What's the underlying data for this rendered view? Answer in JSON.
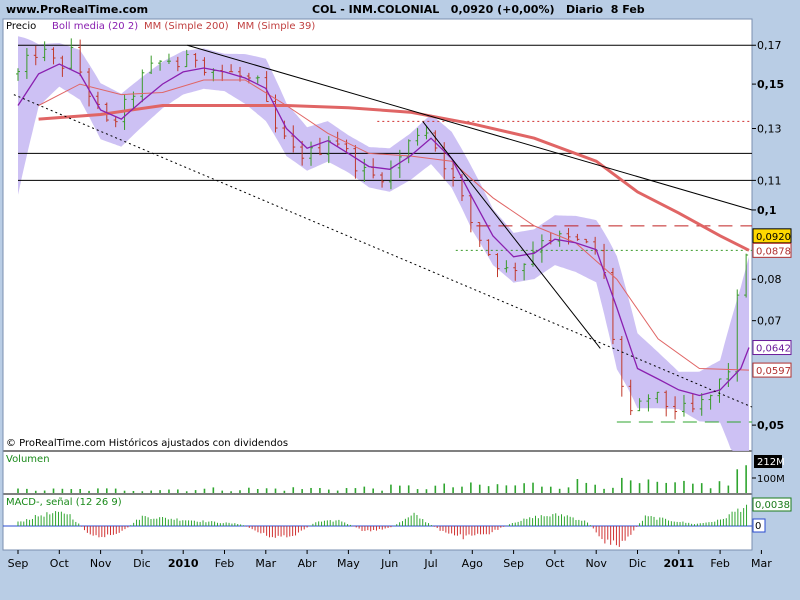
{
  "header": {
    "site": "www.ProRealTime.com",
    "title": "COL - INM.COLONIAL",
    "last": "0,0920 (+0,00%)",
    "period": "Diario",
    "date": "8 Feb"
  },
  "colors": {
    "background": "#b9cde5",
    "panel": "#ffffff",
    "candle_up": "#3a9a2a",
    "candle_down": "#c0392b",
    "bollinger_band": "#c8baf3",
    "bollinger_mid": "#8a20b0",
    "ma200": "#e06565",
    "ma39": "#e06565",
    "volume": "#2fa52f",
    "macd_pos": "#2fa52f",
    "macd_neg": "#d03030"
  },
  "price_panel": {
    "legend": {
      "precio": "Precio",
      "boll": "Boll media (20 2)",
      "ma200": "MM (Simple 200)",
      "ma39": "MM (Simple 39)"
    },
    "footer": "© ProRealTime.com  Históricos ajustados con dividendos",
    "axis_labels": [
      {
        "value": 0.17,
        "text": "0,17",
        "bold": false
      },
      {
        "value": 0.15,
        "text": "0,15",
        "bold": true
      },
      {
        "value": 0.13,
        "text": "0,13",
        "bold": false
      },
      {
        "value": 0.11,
        "text": "0,11",
        "bold": false
      },
      {
        "value": 0.1,
        "text": "0,1",
        "bold": true
      },
      {
        "value": 0.08,
        "text": "0,08",
        "bold": false
      },
      {
        "value": 0.07,
        "text": "0,07",
        "bold": false
      },
      {
        "value": 0.05,
        "text": "0,05",
        "bold": true
      }
    ],
    "price_tags": [
      {
        "value": 0.092,
        "text": "0,0920",
        "bg": "#ffd800",
        "fg": "#000000",
        "border": "#000000"
      },
      {
        "value": 0.0878,
        "text": "0,0878",
        "bg": "#ffffff",
        "fg": "#b03030",
        "border": "#b03030"
      },
      {
        "value": 0.0642,
        "text": "0,0642",
        "bg": "#ffffff",
        "fg": "#6a1b9a",
        "border": "#6a1b9a"
      },
      {
        "value": 0.0597,
        "text": "0,0597",
        "bg": "#ffffff",
        "fg": "#b03030",
        "border": "#b03030"
      }
    ]
  },
  "volume_panel": {
    "label": "Volumen",
    "tags": [
      {
        "text": "212M",
        "bg": "#000000",
        "fg": "#ffffff"
      },
      {
        "text": "100M",
        "bg": "none",
        "fg": "#000000"
      }
    ]
  },
  "macd_panel": {
    "label": "MACD-, señal (12 26 9)",
    "tags": [
      {
        "text": "0,0038",
        "bg": "#ffffff",
        "fg": "#1a7a1a"
      },
      {
        "text": "0",
        "bg": "#ffffff",
        "fg": "#000000"
      }
    ]
  },
  "chart_data": {
    "type": "candlestick",
    "scale": "log",
    "ylim": [
      0.046,
      0.185
    ],
    "x_ticks": [
      {
        "text": "Sep",
        "bold": false
      },
      {
        "text": "Oct",
        "bold": false
      },
      {
        "text": "Nov",
        "bold": false
      },
      {
        "text": "Dic",
        "bold": false
      },
      {
        "text": "2010",
        "bold": true
      },
      {
        "text": "Feb",
        "bold": false
      },
      {
        "text": "Mar",
        "bold": false
      },
      {
        "text": "Abr",
        "bold": false
      },
      {
        "text": "May",
        "bold": false
      },
      {
        "text": "Jun",
        "bold": false
      },
      {
        "text": "Jul",
        "bold": false
      },
      {
        "text": "Ago",
        "bold": false
      },
      {
        "text": "Sep",
        "bold": false
      },
      {
        "text": "Oct",
        "bold": false
      },
      {
        "text": "Nov",
        "bold": false
      },
      {
        "text": "Dic",
        "bold": false
      },
      {
        "text": "2011",
        "bold": true
      },
      {
        "text": "Feb",
        "bold": false
      },
      {
        "text": "Mar",
        "bold": false
      }
    ],
    "price_path": [
      [
        0,
        0.155
      ],
      [
        0.5,
        0.168
      ],
      [
        1,
        0.158
      ],
      [
        1.3,
        0.166
      ],
      [
        1.8,
        0.142
      ],
      [
        2.2,
        0.13
      ],
      [
        2.6,
        0.14
      ],
      [
        3.1,
        0.156
      ],
      [
        3.6,
        0.163
      ],
      [
        4,
        0.158
      ],
      [
        4.2,
        0.166
      ],
      [
        4.6,
        0.158
      ],
      [
        5.2,
        0.155
      ],
      [
        5.8,
        0.15
      ],
      [
        6.2,
        0.13
      ],
      [
        6.7,
        0.12
      ],
      [
        7.2,
        0.12
      ],
      [
        7.6,
        0.128
      ],
      [
        8,
        0.119
      ],
      [
        8.5,
        0.111
      ],
      [
        9,
        0.113
      ],
      [
        9.3,
        0.12
      ],
      [
        9.8,
        0.132
      ],
      [
        10.2,
        0.12
      ],
      [
        10.6,
        0.108
      ],
      [
        11,
        0.095
      ],
      [
        11.4,
        0.087
      ],
      [
        11.8,
        0.082
      ],
      [
        12.3,
        0.085
      ],
      [
        12.7,
        0.092
      ],
      [
        13.2,
        0.091
      ],
      [
        13.6,
        0.09
      ],
      [
        14.1,
        0.087
      ],
      [
        14.5,
        0.06
      ],
      [
        14.8,
        0.051
      ],
      [
        15.3,
        0.055
      ],
      [
        15.8,
        0.053
      ],
      [
        16.3,
        0.052
      ],
      [
        16.8,
        0.055
      ],
      [
        17.2,
        0.06
      ],
      [
        17.5,
        0.08
      ],
      [
        17.7,
        0.092
      ]
    ],
    "ma200_path": [
      [
        0.5,
        0.134
      ],
      [
        2,
        0.136
      ],
      [
        3.5,
        0.14
      ],
      [
        5,
        0.14
      ],
      [
        6.5,
        0.14
      ],
      [
        8,
        0.139
      ],
      [
        9.5,
        0.137
      ],
      [
        11,
        0.132
      ],
      [
        12.5,
        0.126
      ],
      [
        14,
        0.117
      ],
      [
        15,
        0.106
      ],
      [
        16,
        0.099
      ],
      [
        17,
        0.092
      ],
      [
        17.7,
        0.0878
      ]
    ],
    "boll_mid_path": [
      [
        0,
        0.14
      ],
      [
        0.5,
        0.155
      ],
      [
        1,
        0.16
      ],
      [
        1.5,
        0.155
      ],
      [
        2,
        0.138
      ],
      [
        2.5,
        0.134
      ],
      [
        3,
        0.142
      ],
      [
        3.5,
        0.15
      ],
      [
        4,
        0.156
      ],
      [
        4.5,
        0.158
      ],
      [
        5,
        0.156
      ],
      [
        5.5,
        0.153
      ],
      [
        6,
        0.148
      ],
      [
        6.5,
        0.13
      ],
      [
        7,
        0.122
      ],
      [
        7.5,
        0.125
      ],
      [
        8,
        0.12
      ],
      [
        8.5,
        0.115
      ],
      [
        9,
        0.114
      ],
      [
        9.5,
        0.119
      ],
      [
        10,
        0.126
      ],
      [
        10.5,
        0.118
      ],
      [
        11,
        0.104
      ],
      [
        11.5,
        0.092
      ],
      [
        12,
        0.086
      ],
      [
        12.5,
        0.087
      ],
      [
        13,
        0.091
      ],
      [
        13.5,
        0.09
      ],
      [
        14,
        0.088
      ],
      [
        14.5,
        0.073
      ],
      [
        15,
        0.06
      ],
      [
        15.5,
        0.058
      ],
      [
        16,
        0.056
      ],
      [
        16.5,
        0.055
      ],
      [
        17,
        0.056
      ],
      [
        17.5,
        0.06
      ],
      [
        17.7,
        0.0642
      ]
    ],
    "ma39_path": [
      [
        0.5,
        0.14
      ],
      [
        1.5,
        0.15
      ],
      [
        2.5,
        0.145
      ],
      [
        3.5,
        0.146
      ],
      [
        4.5,
        0.152
      ],
      [
        5.5,
        0.152
      ],
      [
        6.5,
        0.14
      ],
      [
        7.5,
        0.128
      ],
      [
        8.5,
        0.12
      ],
      [
        9.5,
        0.119
      ],
      [
        10.5,
        0.117
      ],
      [
        11.5,
        0.104
      ],
      [
        12.5,
        0.095
      ],
      [
        13.5,
        0.09
      ],
      [
        14.5,
        0.08
      ],
      [
        15.5,
        0.066
      ],
      [
        16.5,
        0.06
      ],
      [
        17.7,
        0.0597
      ]
    ],
    "boll_width": [
      [
        0,
        0.25
      ],
      [
        0.5,
        0.1
      ],
      [
        1,
        0.07
      ],
      [
        2,
        0.09
      ],
      [
        3,
        0.08
      ],
      [
        4,
        0.07
      ],
      [
        5,
        0.06
      ],
      [
        6,
        0.1
      ],
      [
        7,
        0.07
      ],
      [
        8,
        0.06
      ],
      [
        9,
        0.07
      ],
      [
        10,
        0.08
      ],
      [
        11,
        0.1
      ],
      [
        12,
        0.08
      ],
      [
        13,
        0.08
      ],
      [
        14,
        0.1
      ],
      [
        14.5,
        0.18
      ],
      [
        15,
        0.12
      ],
      [
        16,
        0.06
      ],
      [
        17,
        0.1
      ],
      [
        17.5,
        0.3
      ],
      [
        17.7,
        0.34
      ]
    ],
    "trendlines": [
      {
        "style": "solid",
        "color": "#000000",
        "points": [
          [
            4.1,
            0.17
          ],
          [
            18.6,
            0.1
          ]
        ]
      },
      {
        "style": "dotted",
        "color": "#000000",
        "points": [
          [
            -0.1,
            0.145
          ],
          [
            18.6,
            0.053
          ]
        ]
      },
      {
        "style": "solid",
        "color": "#000000",
        "points": [
          [
            9.8,
            0.133
          ],
          [
            14.1,
            0.064
          ]
        ]
      }
    ],
    "h_lines": [
      {
        "value": 0.17,
        "style": "solid",
        "color": "#000000",
        "from": 0,
        "to": 18.6
      },
      {
        "value": 0.12,
        "style": "solid",
        "color": "#000000",
        "from": 0,
        "to": 18.6
      },
      {
        "value": 0.11,
        "style": "solid",
        "color": "#000000",
        "from": 0,
        "to": 18.6
      },
      {
        "value": 0.133,
        "style": "dotted",
        "color": "#d03030",
        "from": 8.7,
        "to": 18.6
      },
      {
        "value": 0.095,
        "style": "dashed",
        "color": "#c02020",
        "from": 11.1,
        "to": 18.6
      },
      {
        "value": 0.0878,
        "style": "dotted",
        "color": "#3a9a2a",
        "from": 10.6,
        "to": 18.6
      },
      {
        "value": 0.0505,
        "style": "dashed",
        "color": "#2fa52f",
        "from": 14.5,
        "to": 18.6
      }
    ],
    "volume_path": [
      [
        0,
        0.1
      ],
      [
        4,
        0.12
      ],
      [
        8,
        0.15
      ],
      [
        10,
        0.2
      ],
      [
        12,
        0.25
      ],
      [
        14,
        0.35
      ],
      [
        16,
        0.25
      ],
      [
        17.2,
        0.3
      ],
      [
        17.5,
        0.8
      ],
      [
        17.7,
        1.0
      ]
    ],
    "macd_path": [
      [
        0,
        0.2
      ],
      [
        0.6,
        0.6
      ],
      [
        1.2,
        0.7
      ],
      [
        1.8,
        -0.6
      ],
      [
        2.4,
        -0.5
      ],
      [
        3,
        0.5
      ],
      [
        3.6,
        0.4
      ],
      [
        4.2,
        0.3
      ],
      [
        4.8,
        0.2
      ],
      [
        5.4,
        0.1
      ],
      [
        6,
        -0.5
      ],
      [
        6.6,
        -0.6
      ],
      [
        7.2,
        0.2
      ],
      [
        7.8,
        0.3
      ],
      [
        8.4,
        -0.3
      ],
      [
        9,
        -0.1
      ],
      [
        9.6,
        0.6
      ],
      [
        10.2,
        -0.2
      ],
      [
        10.8,
        -0.6
      ],
      [
        11.4,
        -0.4
      ],
      [
        12,
        0.2
      ],
      [
        12.6,
        0.5
      ],
      [
        13.2,
        0.6
      ],
      [
        13.8,
        0.2
      ],
      [
        14.2,
        -0.8
      ],
      [
        14.6,
        -1.0
      ],
      [
        15.2,
        0.5
      ],
      [
        15.8,
        0.3
      ],
      [
        16.4,
        0.1
      ],
      [
        17,
        0.3
      ],
      [
        17.4,
        0.8
      ],
      [
        17.7,
        1.2
      ]
    ]
  }
}
